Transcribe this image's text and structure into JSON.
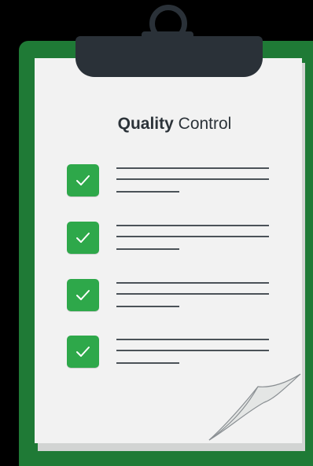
{
  "title": {
    "bold": "Quality",
    "light": "Control"
  },
  "checklist": {
    "items": [
      {
        "checked": true,
        "icon": "check-icon"
      },
      {
        "checked": true,
        "icon": "check-icon"
      },
      {
        "checked": true,
        "icon": "check-icon"
      },
      {
        "checked": true,
        "icon": "check-icon"
      }
    ]
  },
  "colors": {
    "board": "#1f7a36",
    "check": "#2ea84a",
    "clip": "#2a3138",
    "paper": "#f2f2f2",
    "text": "#2c3339"
  }
}
